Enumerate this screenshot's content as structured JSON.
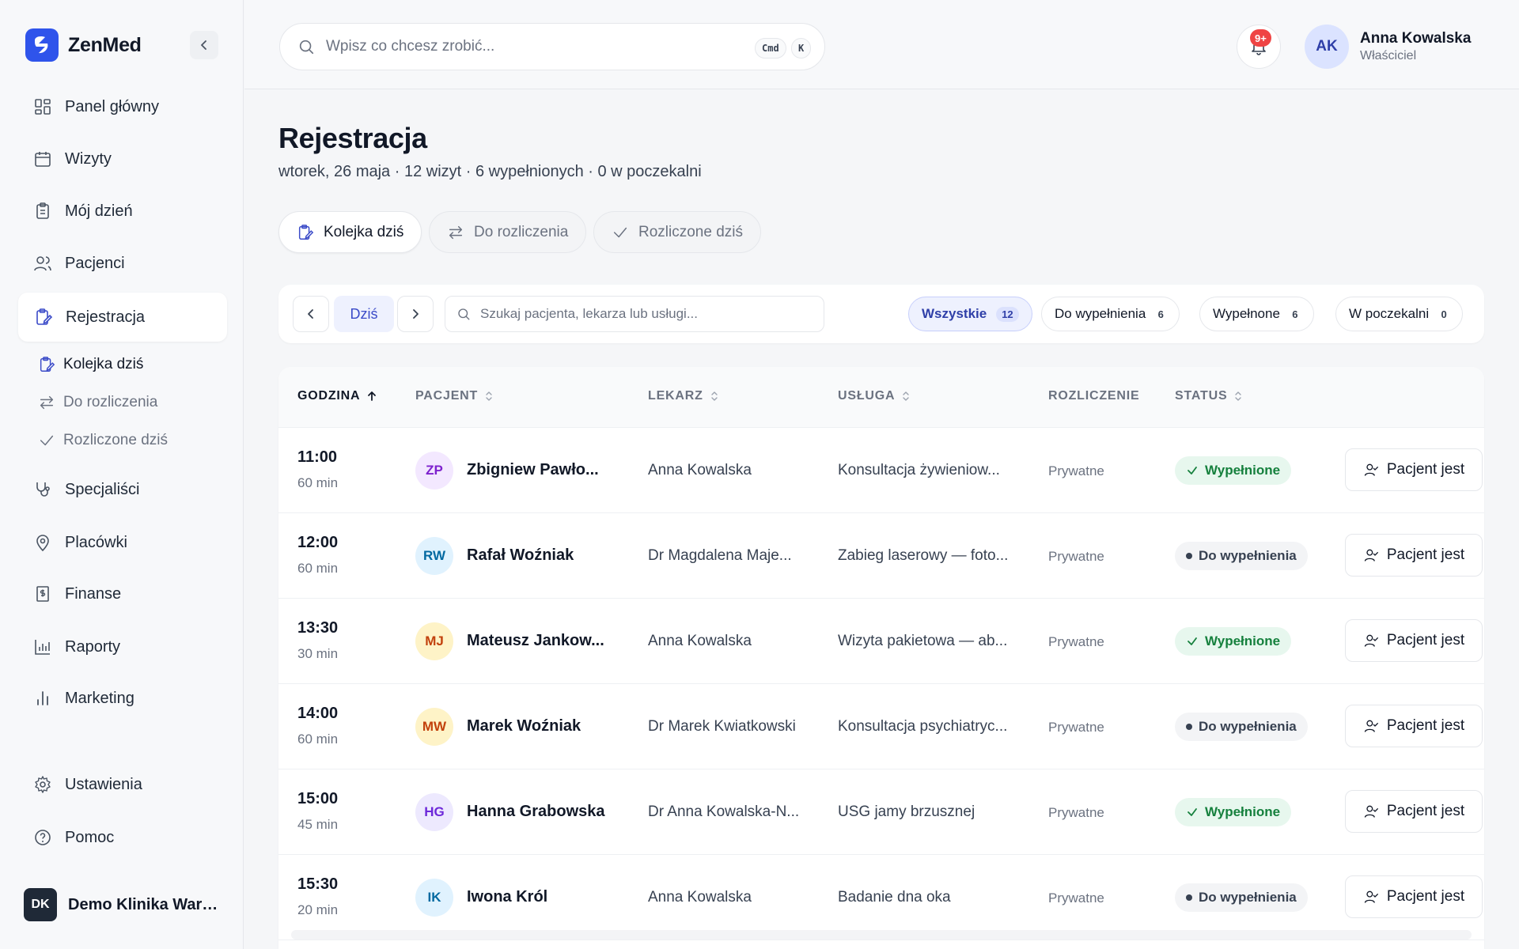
{
  "app": {
    "name": "ZenMed"
  },
  "sidebar": {
    "items": [
      {
        "label": "Panel główny",
        "icon": "grid-icon"
      },
      {
        "label": "Wizyty",
        "icon": "calendar-icon"
      },
      {
        "label": "Mój dzień",
        "icon": "clipboard-icon"
      },
      {
        "label": "Pacjenci",
        "icon": "users-icon"
      },
      {
        "label": "Rejestracja",
        "icon": "clipboard-pen-icon",
        "active": true
      },
      {
        "label": "Specjaliści",
        "icon": "stethoscope-icon"
      },
      {
        "label": "Placówki",
        "icon": "map-pin-icon"
      },
      {
        "label": "Finanse",
        "icon": "dollar-receipt-icon"
      },
      {
        "label": "Raporty",
        "icon": "bar-chart-icon"
      },
      {
        "label": "Marketing",
        "icon": "bar-chart-2-icon"
      },
      {
        "label": "Ustawienia",
        "icon": "gear-icon"
      },
      {
        "label": "Pomoc",
        "icon": "help-circle-icon"
      }
    ],
    "sub_items": [
      {
        "label": "Kolejka dziś",
        "icon": "clipboard-pen-icon",
        "active": true
      },
      {
        "label": "Do rozliczenia",
        "icon": "arrows-swap-icon"
      },
      {
        "label": "Rozliczone dziś",
        "icon": "check-icon"
      }
    ],
    "workspace": {
      "initials": "DK",
      "name": "Demo Klinika Warszawa"
    }
  },
  "topbar": {
    "search_placeholder": "Wpisz co chcesz zrobić...",
    "kbd": [
      "Cmd",
      "K"
    ],
    "notifications_badge": "9+",
    "user": {
      "initials": "AK",
      "name": "Anna Kowalska",
      "role": "Właściciel"
    }
  },
  "page": {
    "title": "Rejestracja",
    "subtitle": "wtorek, 26 maja · 12 wizyt · 6 wypełnionych · 0 w poczekalni"
  },
  "tabs": [
    {
      "label": "Kolejka dziś",
      "active": true
    },
    {
      "label": "Do rozliczenia",
      "active": false
    },
    {
      "label": "Rozliczone dziś",
      "active": false
    }
  ],
  "filters": {
    "today_label": "Dziś",
    "search_placeholder": "Szukaj pacjenta, lekarza lub usługi...",
    "chips": [
      {
        "label": "Wszystkie",
        "count": "12",
        "active": true
      },
      {
        "label": "Do wypełnienia",
        "count": "6"
      },
      {
        "label": "Wypełnone",
        "count": "6"
      },
      {
        "label": "W poczekalni",
        "count": "0"
      }
    ]
  },
  "table": {
    "columns": [
      "GODZINA",
      "PACJENT",
      "LEKARZ",
      "USŁUGA",
      "ROZLICZENIE",
      "STATUS"
    ],
    "action_label": "Pacjent jest",
    "rows": [
      {
        "time": "11:00",
        "duration": "60 min",
        "initials": "ZP",
        "avatar_bg": "#f3e8ff",
        "avatar_fg": "#7e22ce",
        "patient": "Zbigniew Pawło...",
        "doctor": "Anna Kowalska",
        "service": "Konsultacja żywieniow...",
        "billing": "Prywatne",
        "status": "Wypełnione",
        "status_type": "done"
      },
      {
        "time": "12:00",
        "duration": "60 min",
        "initials": "RW",
        "avatar_bg": "#e0f2fe",
        "avatar_fg": "#0369a1",
        "patient": "Rafał Woźniak",
        "doctor": "Dr Magdalena Maje...",
        "service": "Zabieg laserowy — foto...",
        "billing": "Prywatne",
        "status": "Do wypełnienia",
        "status_type": "todo"
      },
      {
        "time": "13:30",
        "duration": "30 min",
        "initials": "MJ",
        "avatar_bg": "#fef3c7",
        "avatar_fg": "#c2410c",
        "patient": "Mateusz Jankow...",
        "doctor": "Anna Kowalska",
        "service": "Wizyta pakietowa — ab...",
        "billing": "Prywatne",
        "status": "Wypełnione",
        "status_type": "done"
      },
      {
        "time": "14:00",
        "duration": "60 min",
        "initials": "MW",
        "avatar_bg": "#fef3c7",
        "avatar_fg": "#c2410c",
        "patient": "Marek Woźniak",
        "doctor": "Dr Marek Kwiatkowski",
        "service": "Konsultacja psychiatryc...",
        "billing": "Prywatne",
        "status": "Do wypełnienia",
        "status_type": "todo"
      },
      {
        "time": "15:00",
        "duration": "45 min",
        "initials": "HG",
        "avatar_bg": "#ede9fe",
        "avatar_fg": "#6d28d9",
        "patient": "Hanna Grabowska",
        "doctor": "Dr Anna Kowalska-N...",
        "service": "USG jamy brzusznej",
        "billing": "Prywatne",
        "status": "Wypełnione",
        "status_type": "done"
      },
      {
        "time": "15:30",
        "duration": "20 min",
        "initials": "IK",
        "avatar_bg": "#e0f2fe",
        "avatar_fg": "#0369a1",
        "patient": "Iwona Król",
        "doctor": "Anna Kowalska",
        "service": "Badanie dna oka",
        "billing": "Prywatne",
        "status": "Do wypełnienia",
        "status_type": "todo"
      }
    ]
  }
}
